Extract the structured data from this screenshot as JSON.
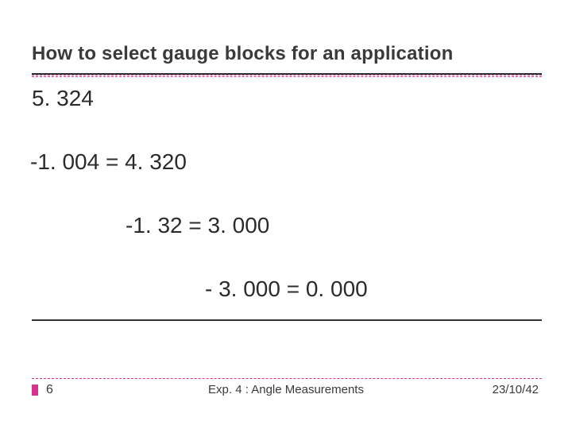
{
  "title": "How to select gauge blocks for an application",
  "body": {
    "line1": "5. 324",
    "line2": "-1. 004 = 4. 320",
    "line3": "-1. 32 = 3. 000",
    "line4": "- 3. 000  = 0. 000"
  },
  "footer": {
    "page_number": "6",
    "center": "Exp. 4 : Angle Measurements",
    "right": "23/10/42"
  }
}
